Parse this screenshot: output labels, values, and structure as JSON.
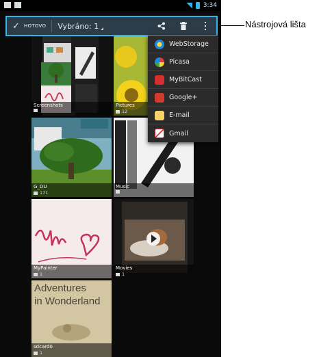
{
  "status_bar": {
    "time": "3:34",
    "accent": "#33b5e5"
  },
  "action_bar": {
    "done_label": "HOTOVO",
    "selected_label": "Vybráno: 1",
    "icons": [
      "check-icon",
      "share-icon",
      "delete-icon",
      "overflow-menu-icon"
    ],
    "highlight_color": "#33b5e5"
  },
  "share_menu": {
    "items": [
      {
        "label": "WebStorage",
        "icon": "webstorage-icon"
      },
      {
        "label": "Picasa",
        "icon": "picasa-icon"
      },
      {
        "label": "MyBitCast",
        "icon": "mybitcast-icon"
      },
      {
        "label": "Google+",
        "icon": "google-plus-icon"
      },
      {
        "label": "E-mail",
        "icon": "email-icon"
      },
      {
        "label": "Gmail",
        "icon": "gmail-icon"
      }
    ]
  },
  "albums": [
    {
      "name": "Screenshots",
      "count": ""
    },
    {
      "name": "Pictures",
      "count": "12"
    },
    {
      "name": "G_DU",
      "count": "171"
    },
    {
      "name": "Music",
      "count": ""
    },
    {
      "name": "MyPainter",
      "count": "1"
    },
    {
      "name": "Movies",
      "count": "1"
    },
    {
      "name": "sdcard0",
      "count": "1"
    }
  ],
  "wonderland_text": {
    "line1": "Adventures",
    "line2": "in Wonderland"
  },
  "annotation": {
    "label": "Nástrojová lišta"
  }
}
